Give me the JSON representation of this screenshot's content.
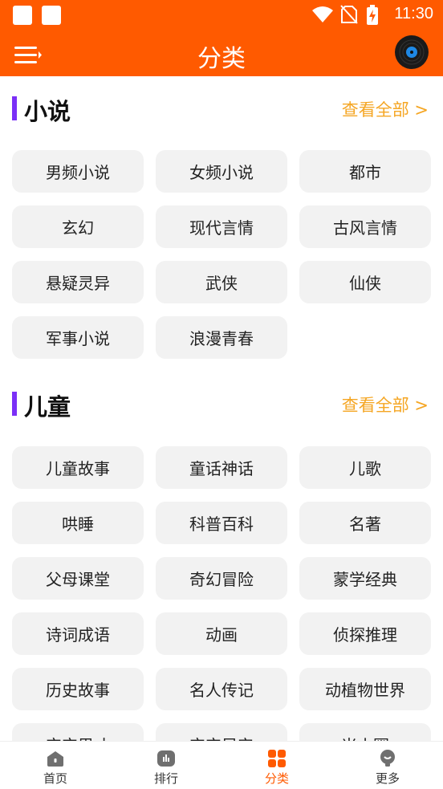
{
  "status_bar": {
    "time": "11:30"
  },
  "header": {
    "title": "分类"
  },
  "sections": [
    {
      "title": "小说",
      "more": "查看全部 >",
      "items": [
        "男频小说",
        "女频小说",
        "都市",
        "玄幻",
        "现代言情",
        "古风言情",
        "悬疑灵异",
        "武侠",
        "仙侠",
        "军事小说",
        "浪漫青春"
      ]
    },
    {
      "title": "儿童",
      "more": "查看全部 >",
      "items": [
        "儿童故事",
        "童话神话",
        "儿歌",
        "哄睡",
        "科普百科",
        "名著",
        "父母课堂",
        "奇幻冒险",
        "蒙学经典",
        "诗词成语",
        "动画",
        "侦探推理",
        "历史故事",
        "名人传记",
        "动植物世界",
        "宝宝思才",
        "宝宝早安",
        "米小圈"
      ]
    }
  ],
  "tabs": [
    {
      "label": "首页",
      "icon": "home-icon"
    },
    {
      "label": "排行",
      "icon": "ranking-icon"
    },
    {
      "label": "分类",
      "icon": "category-icon",
      "active": true
    },
    {
      "label": "更多",
      "icon": "more-icon"
    }
  ],
  "colors": {
    "accent": "#ff5a00",
    "section_bar": "#7b2ff7",
    "more_link": "#f5a623"
  }
}
